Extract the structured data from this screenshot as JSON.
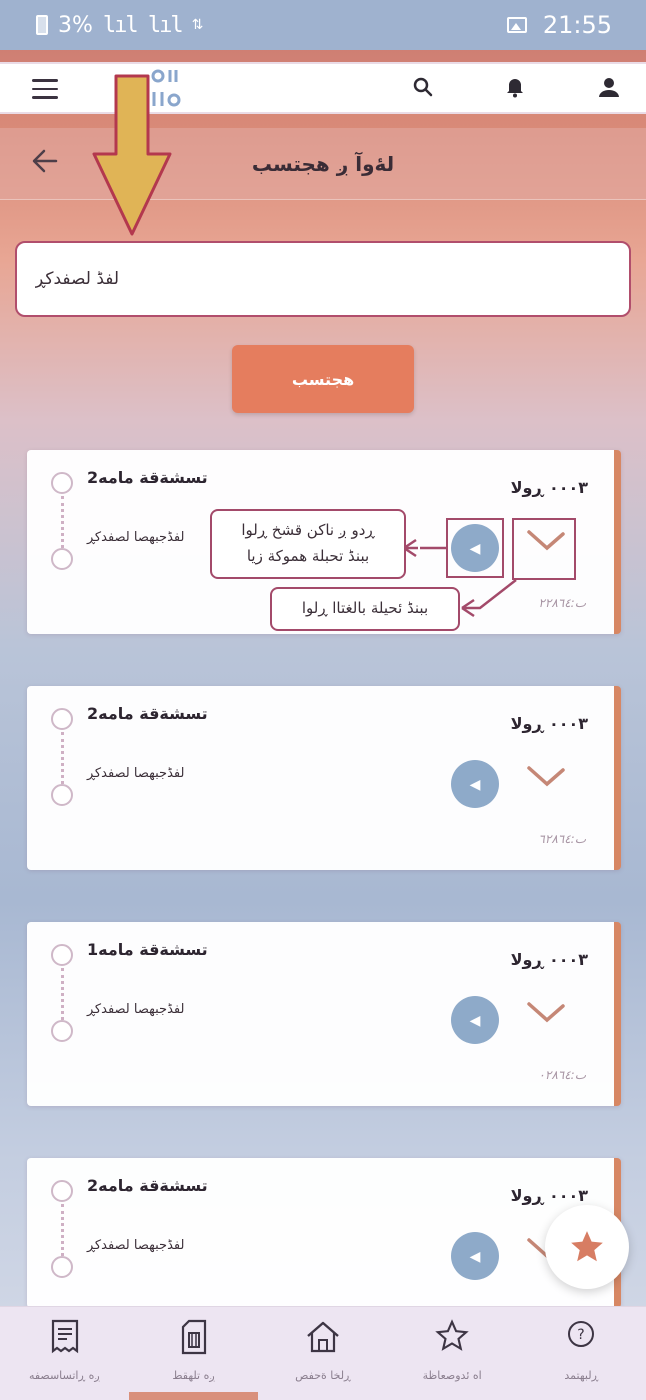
{
  "status_bar": {
    "time": "21:55",
    "battery": "3%"
  },
  "page": {
    "title": "لۀوآ ږ هجتسب",
    "search_value": "لفڈ لصفدكڕ",
    "submit_label": "هجتسب"
  },
  "cards": [
    {
      "title": "2تسشةقة مامه",
      "subtitle": "لفڈجبهصا لصفدكڕ",
      "code": "٠٠٠٣ ڕولا",
      "date": "ٮ:٢٢٨٦٤"
    },
    {
      "title": "2تسشةقة مامه",
      "subtitle": "لفڈجبهصا لصفدكڕ",
      "code": "٠٠٠٣ ڕولا",
      "date": "ٮ:٦٢٨٦٤"
    },
    {
      "title": "1تسشةقة مامه",
      "subtitle": "لفڈجبهصا لصفدكڕ",
      "code": "٠٠٠٣ ڕولا",
      "date": "ٮ:٠٢٨٦٤"
    },
    {
      "title": "2تسشةقة مامه",
      "subtitle": "لفڈجبهصا لصفدكڕ",
      "code": "٠٠٠٣ ڕولا",
      "date": ""
    }
  ],
  "callouts": {
    "play_line1": "ڕدو ږ ناكن قشخ ڕلوا",
    "play_line2": "ببنڈ تحبلة هموكة زيا",
    "chevron": "ببنڈ ئحيلة بالغتاا ڕلوا"
  },
  "bottom_nav": [
    {
      "label": "ږه ڕاتساسصفه"
    },
    {
      "label": "ږه تلهقط"
    },
    {
      "label": "ڕلخا ةحفص"
    },
    {
      "label": "اه ئدوصعاظة"
    },
    {
      "label": "ڕلبهتمد"
    }
  ],
  "colors": {
    "accent": "#e57d5e",
    "highlight": "#a34a6a",
    "play": "#8eaac9"
  }
}
